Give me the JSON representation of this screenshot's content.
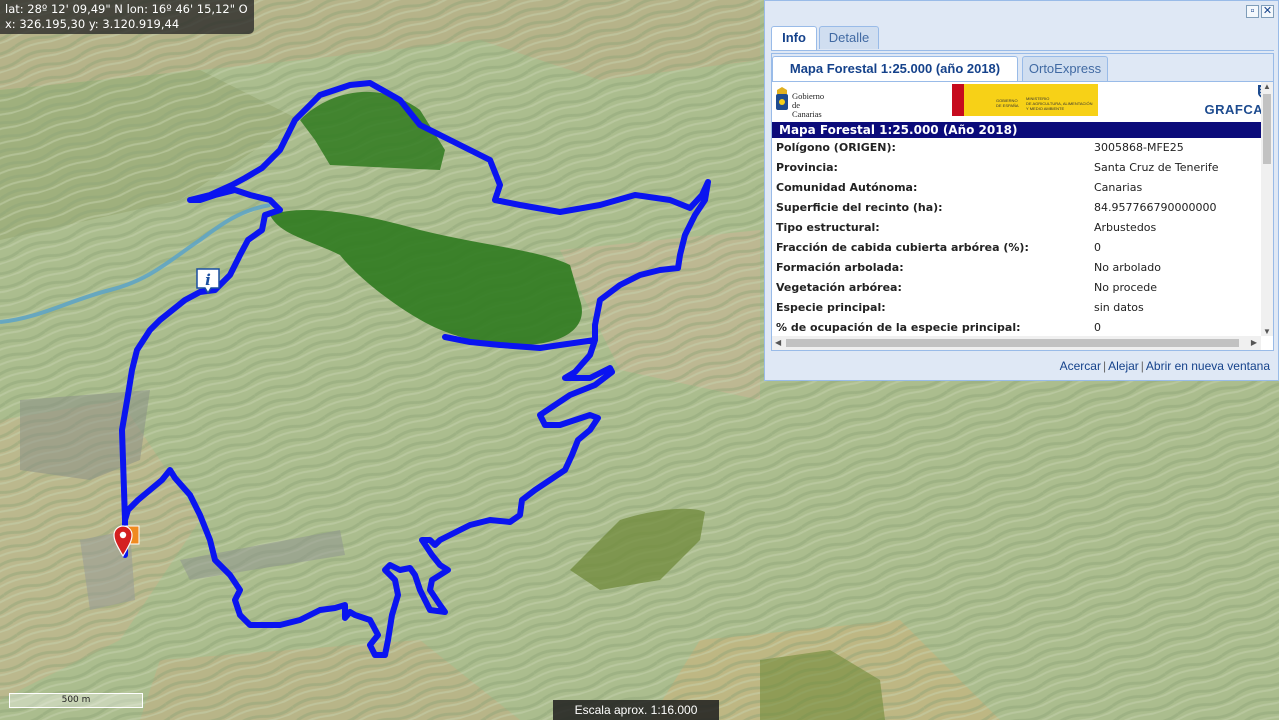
{
  "coords": {
    "line1": "lat: 28º 12' 09,49\" N  lon: 16º 46' 15,12\" O",
    "line2": "x: 326.195,30  y: 3.120.919,44"
  },
  "scale": {
    "bar_label": "500 m",
    "text": "Escala aprox. 1:16.000"
  },
  "panel": {
    "tabs": [
      "Info",
      "Detalle"
    ],
    "subtabs": [
      "Mapa Forestal 1:25.000 (año 2018)",
      "OrtoExpress"
    ],
    "logos": {
      "gobierno_canarias": "Gobierno de Canarias",
      "grafcan": "GRAFCAN"
    },
    "section_title": "Mapa Forestal 1:25.000 (Año 2018)",
    "rows": [
      {
        "label": "Polígono (ORIGEN):",
        "value": "3005868-MFE25"
      },
      {
        "label": "Provincia:",
        "value": "Santa Cruz de Tenerife"
      },
      {
        "label": "Comunidad Autónoma:",
        "value": "Canarias"
      },
      {
        "label": "Superficie del recinto (ha):",
        "value": "84.957766790000000"
      },
      {
        "label": "Tipo estructural:",
        "value": "Arbustedos"
      },
      {
        "label": "Fracción de cabida cubierta arbórea (%):",
        "value": "0"
      },
      {
        "label": "Formación arbolada:",
        "value": "No arbolado"
      },
      {
        "label": "Vegetación arbórea:",
        "value": "No procede"
      },
      {
        "label": "Especie principal:",
        "value": "sin datos"
      },
      {
        "label": "% de ocupación de la especie principal:",
        "value": "0"
      }
    ],
    "links": {
      "acercar": "Acercar",
      "alejar": "Alejar",
      "nueva_ventana": "Abrir en nueva ventana",
      "separator": "|"
    }
  },
  "colors": {
    "route": "#0a14f0",
    "forest_polygon": "#2f7a1f",
    "panel_header": "#0b0b7a"
  },
  "icons": {
    "info_marker": "info-icon",
    "start_marker": "map-pin-icon",
    "maximize": "maximize-icon",
    "close": "close-icon"
  }
}
